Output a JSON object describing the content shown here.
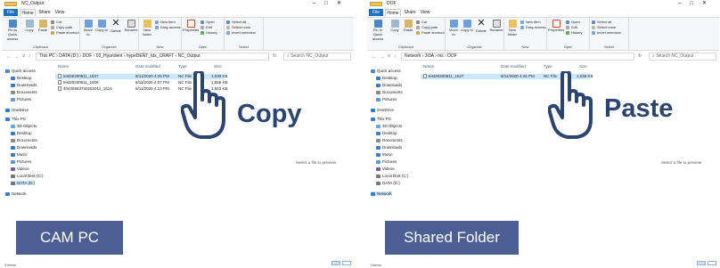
{
  "common": {
    "window_buttons": [
      "–",
      "□",
      "✕"
    ],
    "menu_tabs": [
      "File",
      "Home",
      "Share",
      "View"
    ],
    "ribbon": {
      "pin_label": "Pin to Quick access",
      "copy": "Copy",
      "paste": "Paste",
      "cut": "Cut",
      "copy_path": "Copy path",
      "paste_shortcut": "Paste shortcut",
      "move_to": "Move to",
      "copy_to": "Copy to",
      "delete": "Delete",
      "rename": "Rename",
      "new_folder": "New folder",
      "new_item": "New item",
      "easy_access": "Easy access",
      "properties": "Properties",
      "open": "Open",
      "edit": "Edit",
      "history": "History",
      "select_all": "Select all",
      "select_none": "Select none",
      "invert_selection": "Invert selection",
      "groups": [
        "Clipboard",
        "Organize",
        "New",
        "Open",
        "Select"
      ]
    },
    "columns": [
      "Name",
      "Date modified",
      "Type",
      "Size"
    ],
    "nav": [
      "Quick access",
      "Desktop",
      "Downloads",
      "Documents",
      "Pictures",
      "OneDrive",
      "This PC",
      "3D Objects",
      "Desktop",
      "Documents",
      "Downloads",
      "Music",
      "Pictures",
      "Videos",
      "Local Disk (C:)",
      "DATA (D:)",
      "Network"
    ],
    "preview_text": "Select a file to preview.",
    "colors": {
      "accent": "#1e6fbf",
      "selection": "#cce8ff",
      "label_box": "#4b5f94",
      "label_text": "#2b4470"
    }
  },
  "left": {
    "title": "NC_Output",
    "path": "This PC  ›  DATA (D:)  ›  DOF  ›  03_Hyundent  ›  hypeDENT_tds_CRAFT  ›  NC_Output",
    "search_placeholder": "Search NC_Output",
    "files": [
      {
        "name": "test20200811_1627",
        "date": "8/11/2020 4:25 PM",
        "type": "NC File",
        "size": "1,039 KB"
      },
      {
        "name": "test20200811_1608",
        "date": "8/11/2020 4:07 PM",
        "type": "NC File",
        "size": "1,555 KB"
      },
      {
        "name": "40435983740202011_1614",
        "date": "8/11/2020 4:13 PM",
        "type": "NC File",
        "size": "1,553 KB"
      }
    ],
    "status": "3 items",
    "caption": "CAM PC",
    "action": "Copy"
  },
  "right": {
    "title": "DOF",
    "path": "Network  ›  3I3A  ›  nis  ›  DOF",
    "search_placeholder": "Search NC_Output",
    "files": [
      {
        "name": "test20200811_1627",
        "date": "8/11/2020 4:25 PM",
        "type": "NC File",
        "size": "1,039 KB"
      }
    ],
    "status": "1 items",
    "caption": "Shared Folder",
    "action": "Paste"
  }
}
